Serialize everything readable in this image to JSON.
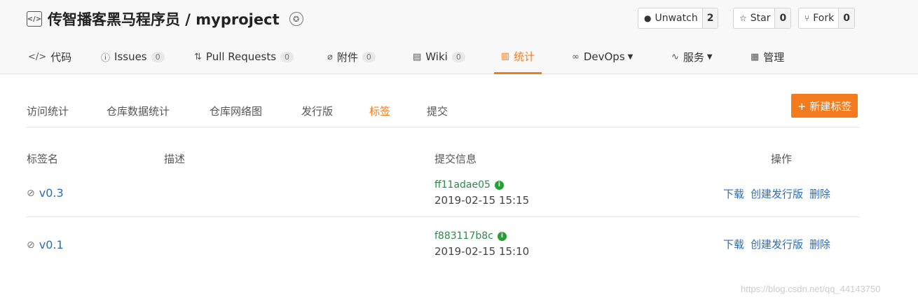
{
  "repo": {
    "title": "传智播客黑马程序员 / myproject",
    "code_icon": "code-icon",
    "badge_icon": "recommend-badge-icon"
  },
  "actions": [
    {
      "label": "Unwatch",
      "count": "2",
      "icon": "eye-icon"
    },
    {
      "label": "Star",
      "count": "0",
      "icon": "star-icon"
    },
    {
      "label": "Fork",
      "count": "0",
      "icon": "fork-icon"
    }
  ],
  "nav": [
    {
      "label": "代码",
      "icon": "code-icon",
      "count": ""
    },
    {
      "label": "Issues",
      "icon": "issue-icon",
      "count": "0"
    },
    {
      "label": "Pull Requests",
      "icon": "pull-request-icon",
      "count": "0"
    },
    {
      "label": "附件",
      "icon": "attachment-icon",
      "count": "0"
    },
    {
      "label": "Wiki",
      "icon": "wiki-icon",
      "count": "0"
    },
    {
      "label": "统计",
      "icon": "bar-chart-icon",
      "count": ""
    },
    {
      "label": "DevOps",
      "icon": "infinity-icon",
      "count": ""
    },
    {
      "label": "服务",
      "icon": "pulse-icon",
      "count": ""
    },
    {
      "label": "管理",
      "icon": "settings-doc-icon",
      "count": ""
    }
  ],
  "subtabs": [
    "访问统计",
    "仓库数据统计",
    "仓库网络图",
    "发行版",
    "标签",
    "提交"
  ],
  "new_tag_button": "+ 新建标签",
  "table": {
    "headers": [
      "标签名",
      "描述",
      "提交信息",
      "操作"
    ],
    "rows": [
      {
        "tag": "v0.3",
        "sha": "ff11adae05",
        "date": "2019-02-15 15:15",
        "ops": [
          "下载",
          "创建发行版",
          "删除"
        ]
      },
      {
        "tag": "v0.1",
        "sha": "f883117b8c",
        "date": "2019-02-15 15:10",
        "ops": [
          "下载",
          "创建发行版",
          "删除"
        ]
      }
    ]
  },
  "watermark": "https://blog.csdn.net/qq_44143750",
  "colors": {
    "accent": "#f37b1d",
    "link": "#2a6ebb",
    "commit": "#2e8a4a"
  }
}
